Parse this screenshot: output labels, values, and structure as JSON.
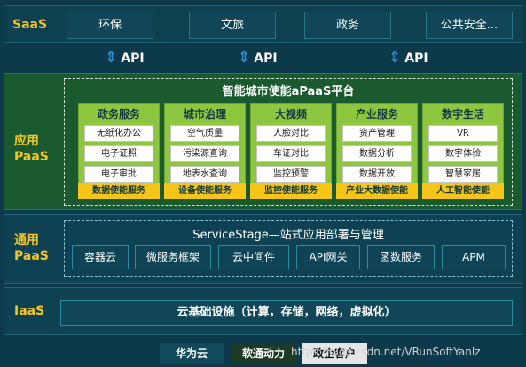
{
  "saas": {
    "label": "SaaS",
    "items": [
      "环保",
      "文旅",
      "政务",
      "公共安全..."
    ]
  },
  "api_label": "API",
  "app_paas": {
    "label_line1": "应用",
    "label_line2": "PaaS",
    "platform_title": "智能城市使能aPaaS平台",
    "columns": [
      {
        "title": "政务服务",
        "items": [
          "无纸化办公",
          "电子证照",
          "电子审批"
        ],
        "enabler": "数据使能服务"
      },
      {
        "title": "城市治理",
        "items": [
          "空气质量",
          "污染源查询",
          "地表水查询"
        ],
        "enabler": "设备使能服务"
      },
      {
        "title": "大视频",
        "items": [
          "人脸对比",
          "车证对比",
          "监控预警"
        ],
        "enabler": "监控使能服务"
      },
      {
        "title": "产业服务",
        "items": [
          "资产管理",
          "数据分析",
          "数据开放"
        ],
        "enabler": "产业大数据使能"
      },
      {
        "title": "数字生活",
        "items": [
          "VR",
          "数字体验",
          "智慧家居"
        ],
        "enabler": "人工智能使能"
      }
    ]
  },
  "gen_paas": {
    "label_line1": "通用",
    "label_line2": "PaaS",
    "title": "ServiceStage—站式应用部署与管理",
    "items": [
      "容器云",
      "微服务框架",
      "云中间件",
      "API网关",
      "函数服务",
      "APM"
    ]
  },
  "iaas": {
    "label": "IaaS",
    "content": "云基础设施（计算，存储，网络，虚拟化）"
  },
  "footer": {
    "tabs": [
      "华为云",
      "软通动力",
      "政企客户"
    ],
    "watermark": "https://blog.csdn.net/VRunSoftYanlz"
  },
  "colors": {
    "background": "#0c3a4a",
    "accent_yellow": "#f3c623",
    "column_green": "#8fc63f",
    "enabler_yellow": "#f5c518",
    "arrow_blue": "#2f8fd3"
  }
}
